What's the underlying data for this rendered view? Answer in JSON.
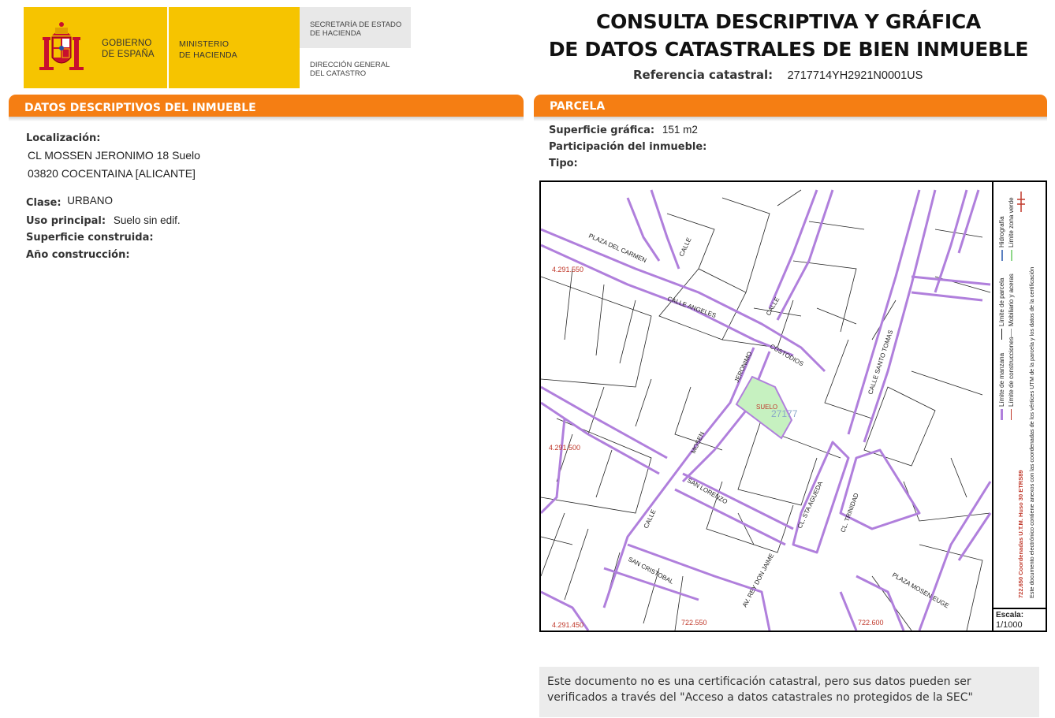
{
  "header": {
    "gov_line1": "GOBIERNO",
    "gov_line2": "DE ESPAÑA",
    "min_line1": "MINISTERIO",
    "min_line2": "DE HACIENDA",
    "sec_line1": "SECRETARÍA DE ESTADO",
    "sec_line2": "DE HACIENDA",
    "dir_line1": "DIRECCIÓN GENERAL",
    "dir_line2": "DEL CATASTRO",
    "title_line1": "CONSULTA DESCRIPTIVA Y GRÁFICA",
    "title_line2": "DE DATOS CATASTRALES DE BIEN INMUEBLE",
    "ref_label": "Referencia catastral:",
    "ref_value": "2717714YH2921N0001US"
  },
  "descriptive": {
    "section_title": "DATOS DESCRIPTIVOS DEL INMUEBLE",
    "localizacion_label": "Localización:",
    "address_line1": "CL MOSSEN JERONIMO 18 Suelo",
    "address_line2": "03820 COCENTAINA [ALICANTE]",
    "clase_label": "Clase:",
    "clase_value": "URBANO",
    "uso_label": "Uso principal:",
    "uso_value": "Suelo sin edif.",
    "superficie_label": "Superficie construida:",
    "anio_label": "Año construcción:"
  },
  "parcela": {
    "section_title": "PARCELA",
    "superficie_label": "Superficie gráfica:",
    "superficie_value": "151 m2",
    "participacion_label": "Participación del inmueble:",
    "tipo_label": "Tipo:"
  },
  "map": {
    "coord_y1": "4.291.550",
    "coord_y2": "4.291.500",
    "coord_y3": "4.291.450",
    "coord_x1": "722.550",
    "coord_x2": "722.600",
    "parcel_label": "SUELO",
    "parcel_ref": "27177",
    "escala_label": "Escala:",
    "escala_value": "1/1000",
    "legend": {
      "manzana": "Límite de manzana",
      "construcciones": "Límite de construcciones",
      "parcela": "Límite de parcela",
      "mobiliario": "Mobiliario y aceras",
      "hidrografia": "Hidrografía",
      "zona_verde": "Límite zona verde",
      "coords": "722.650 Coordenadas U.T.M. Huso 30 ETRS89",
      "doc_note": "Este documento electrónico contiene anexos con las coordenadas de los vértices UTM de la parcela y los datos de la certificación"
    },
    "streets": {
      "plaza_carmen": "PLAZA DEL CARMEN",
      "calle_angeles": "CALLE ANGELES",
      "custodios": "CUSTODIOS",
      "calle_santo_tomas": "CALLE SANTO TOMAS",
      "jeronimo": "JERONIMO",
      "mosen": "MOSEN",
      "san_lorenzo": "SAN LORENZO",
      "cl_sta_agueda": "CL. STA AGUEDA",
      "cl_trinidad": "CL. TRINIDAD",
      "san_cristobal": "SAN CRISTOBAL",
      "av_rey_don_jaime": "AV. REY DON JAIME",
      "plaza_mosen": "PLAZA MOSEN EUGE",
      "calle_a": "CALLE",
      "calle_b": "CALLE",
      "calle_c": "CALLE"
    }
  },
  "footer_note": "Este documento no es una certificación catastral, pero sus datos pueden ser verificados a través del \"Acceso a datos catastrales no protegidos de la SEC\"",
  "colors": {
    "orange": "#f57e13",
    "yellow": "#f6c400",
    "purple": "#b07fdc",
    "parcel_green": "#c6f1c0",
    "coord_red": "#c0392b"
  }
}
